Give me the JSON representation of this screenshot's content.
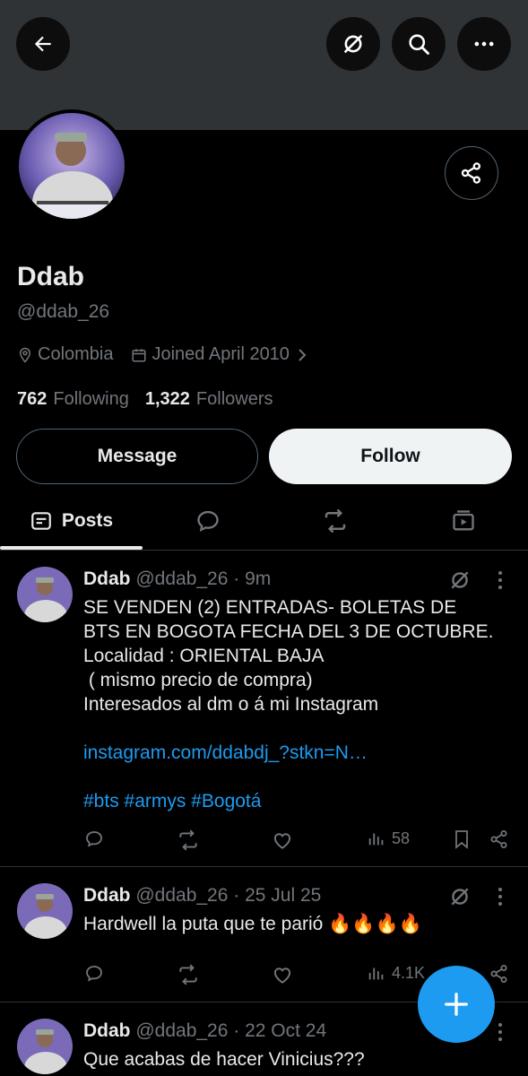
{
  "header": {
    "back": "back-arrow",
    "grok": "grok-icon",
    "search": "search-icon",
    "more": "more-icon"
  },
  "profile": {
    "name": "Ddab",
    "handle": "@ddab_26",
    "location": "Colombia",
    "joined": "Joined April 2010",
    "following_count": "762",
    "following_label": "Following",
    "followers_count": "1,322",
    "followers_label": "Followers",
    "message_label": "Message",
    "follow_label": "Follow"
  },
  "tabs": [
    {
      "label": "Posts",
      "icon": "posts-icon"
    },
    {
      "label": "",
      "icon": "replies-icon"
    },
    {
      "label": "",
      "icon": "reposts-icon"
    },
    {
      "label": "",
      "icon": "media-icon"
    }
  ],
  "posts": [
    {
      "name": "Ddab",
      "handle": "@ddab_26",
      "time": "· 9m",
      "lines": [
        "SE VENDEN (2) ENTRADAS- BOLETAS DE",
        "BTS EN BOGOTA FECHA DEL 3 DE OCTUBRE.",
        "Localidad : ORIENTAL BAJA",
        " ( mismo precio de compra)",
        "Interesados al dm o á mi Instagram"
      ],
      "link": "instagram.com/ddabdj_?stkn=N…",
      "hashtags": "#bts #armys #Bogotá",
      "views": "58"
    },
    {
      "name": "Ddab",
      "handle": "@ddab_26",
      "time": "· 25 Jul 25",
      "text": "Hardwell la puta que te parió 🔥🔥🔥🔥",
      "views": "4.1K"
    },
    {
      "name": "Ddab",
      "handle": "@ddab_26",
      "time": "· 22 Oct 24",
      "text": "Que acabas de hacer Vinicius???"
    }
  ],
  "colors": {
    "accent": "#1d9bf0",
    "muted": "#71767b",
    "text": "#e7e9ea"
  }
}
